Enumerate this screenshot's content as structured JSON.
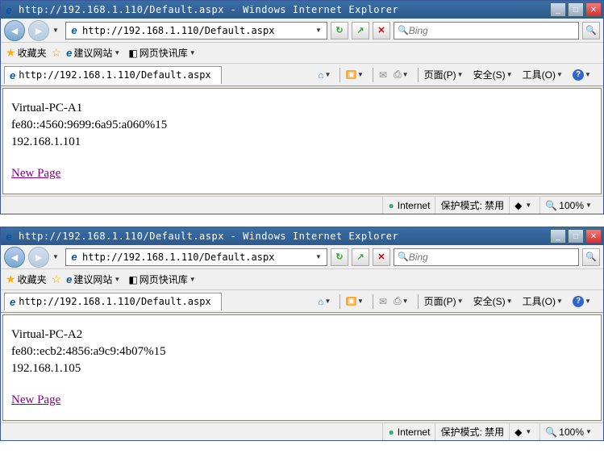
{
  "windows": [
    {
      "title": "http://192.168.1.110/Default.aspx - Windows Internet Explorer",
      "url": "http://192.168.1.110/Default.aspx",
      "search_placeholder": "Bing",
      "favorites_label": "收藏夹",
      "suggested_sites": "建议网站",
      "web_slice": "网页快讯库",
      "tab_label": "http://192.168.1.110/Default.aspx",
      "cmd_page": "页面(P)",
      "cmd_safety": "安全(S)",
      "cmd_tools": "工具(O)",
      "content_line1": "Virtual-PC-A1",
      "content_line2": "fe80::4560:9699:6a95:a060%15",
      "content_line3": "192.168.1.101",
      "link_text": "New Page",
      "status_zone": "Internet",
      "status_protected": "保护模式: 禁用",
      "zoom": "100%"
    },
    {
      "title": "http://192.168.1.110/Default.aspx - Windows Internet Explorer",
      "url": "http://192.168.1.110/Default.aspx",
      "search_placeholder": "Bing",
      "favorites_label": "收藏夹",
      "suggested_sites": "建议网站",
      "web_slice": "网页快讯库",
      "tab_label": "http://192.168.1.110/Default.aspx",
      "cmd_page": "页面(P)",
      "cmd_safety": "安全(S)",
      "cmd_tools": "工具(O)",
      "content_line1": "Virtual-PC-A2",
      "content_line2": "fe80::ecb2:4856:a9c9:4b07%15",
      "content_line3": "192.168.1.105",
      "link_text": "New Page",
      "status_zone": "Internet",
      "status_protected": "保护模式: 禁用",
      "zoom": "100%"
    }
  ]
}
